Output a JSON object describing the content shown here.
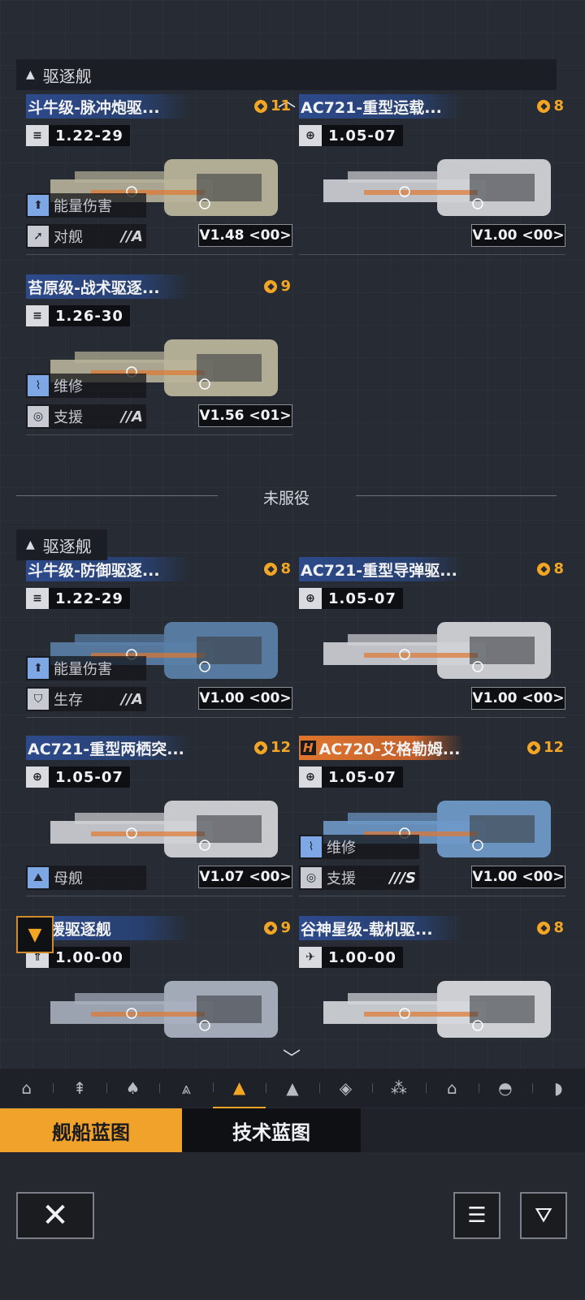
{
  "colors": {
    "accent": "#f3a623",
    "title_blue": "#2d4a8c",
    "title_orange": "#e0772f",
    "bg": "#272b33"
  },
  "section1": {
    "label": "驱逐舰"
  },
  "divider": {
    "label": "未服役"
  },
  "section2": {
    "label": "驱逐舰"
  },
  "cards": [
    {
      "title": "斗牛级-脉冲炮驱...",
      "cost": "11",
      "stat_icon": "speed-icon",
      "stat": "1.22-29",
      "tags": [
        {
          "label": "能量伤害",
          "icon": "energy-damage-icon",
          "grade": ""
        },
        {
          "label": "对舰",
          "icon": "anti-ship-icon",
          "grade": "//A"
        }
      ],
      "version": "V1.48 <00>"
    },
    {
      "title": "AC721-重型运载...",
      "cost": "8",
      "stat_icon": "globe-icon",
      "stat": "1.05-07",
      "tags": [],
      "version": "V1.00 <00>"
    },
    {
      "title": "苔原级-战术驱逐...",
      "cost": "9",
      "stat_icon": "speed-icon",
      "stat": "1.26-30",
      "tags": [
        {
          "label": "维修",
          "icon": "repair-icon",
          "grade": ""
        },
        {
          "label": "支援",
          "icon": "support-icon",
          "grade": "//A"
        }
      ],
      "version": "V1.56 <01>"
    },
    {
      "title": "斗牛级-防御驱逐...",
      "cost": "8",
      "stat_icon": "speed-icon",
      "stat": "1.22-29",
      "tags": [
        {
          "label": "能量伤害",
          "icon": "energy-damage-icon",
          "grade": ""
        },
        {
          "label": "生存",
          "icon": "survival-icon",
          "grade": "//A"
        }
      ],
      "version": "V1.00 <00>"
    },
    {
      "title": "AC721-重型导弹驱...",
      "cost": "8",
      "stat_icon": "globe-icon",
      "stat": "1.05-07",
      "tags": [],
      "version": "V1.00 <00>"
    },
    {
      "title": "AC721-重型两栖突...",
      "cost": "12",
      "stat_icon": "globe-icon",
      "stat": "1.05-07",
      "tags": [
        {
          "label": "母舰",
          "icon": "carrier-icon",
          "grade": ""
        }
      ],
      "version": "V1.07 <00>"
    },
    {
      "title": "AC720-艾格勒姆...",
      "cost": "12",
      "stat_icon": "globe-icon",
      "stat": "1.05-07",
      "badge": "H",
      "tags": [
        {
          "label": "维修",
          "icon": "repair-icon",
          "grade": ""
        },
        {
          "label": "支援",
          "icon": "support-icon",
          "grade": "///S"
        }
      ],
      "version": "V1.00 <00>"
    },
    {
      "title": "-支援驱逐舰",
      "cost": "9",
      "stat_icon": "rocket-icon",
      "stat": "1.00-00",
      "tags": [],
      "version": ""
    },
    {
      "title": "谷神星级-载机驱...",
      "cost": "8",
      "stat_icon": "fighter-icon",
      "stat": "1.00-00",
      "tags": [],
      "version": ""
    }
  ],
  "tabs": [
    "tab-1",
    "tab-2",
    "tab-3",
    "tab-4",
    "tab-destroyer",
    "tab-6",
    "tab-7",
    "tab-8",
    "tab-9",
    "tab-10",
    "tab-11"
  ],
  "bp_tabs": {
    "ship": "舰船蓝图",
    "tech": "技术蓝图"
  }
}
